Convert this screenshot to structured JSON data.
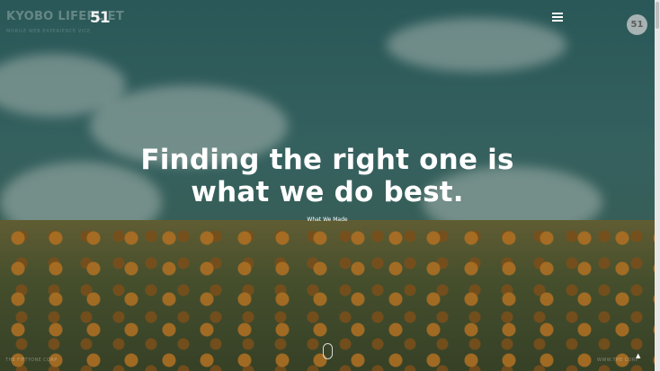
{
  "brand": {
    "name": "KYOBO LIFEPL    ET",
    "tagline": "MOBILE WEB EXPERIENCE    VICE"
  },
  "logo": {
    "text": "51"
  },
  "menu": {
    "icon": "hamburger-menu-icon"
  },
  "badge": {
    "text": "51"
  },
  "hero": {
    "headline_line1": "Finding the right one is",
    "headline_line2": "what we do best.",
    "cta_label": "What We Made"
  },
  "footer": {
    "left": "THE FIFTYONE CORP",
    "right": "WWW.THE    CORP"
  },
  "colors": {
    "accent": "#ffffff",
    "overlay": "#3e706d"
  }
}
